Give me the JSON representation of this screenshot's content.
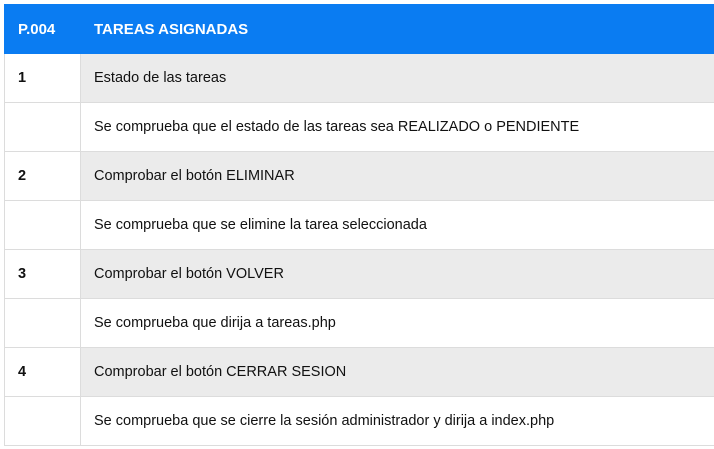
{
  "header": {
    "code": "P.004",
    "title": "TAREAS ASIGNADAS"
  },
  "rows": [
    {
      "number": "1",
      "step": "Estado de las tareas",
      "detail": "Se comprueba que el estado de las tareas sea REALIZADO o PENDIENTE"
    },
    {
      "number": "2",
      "step": "Comprobar el botón ELIMINAR",
      "detail": "Se comprueba que se elimine la tarea seleccionada"
    },
    {
      "number": "3",
      "step": "Comprobar el botón VOLVER",
      "detail": "Se comprueba que dirija a tareas.php"
    },
    {
      "number": "4",
      "step": "Comprobar el botón CERRAR SESION",
      "detail": "Se comprueba que se cierre la sesión administrador y dirija a index.php"
    }
  ],
  "colors": {
    "header_bg": "#0a7cf2",
    "step_row_bg": "#ebebeb"
  }
}
